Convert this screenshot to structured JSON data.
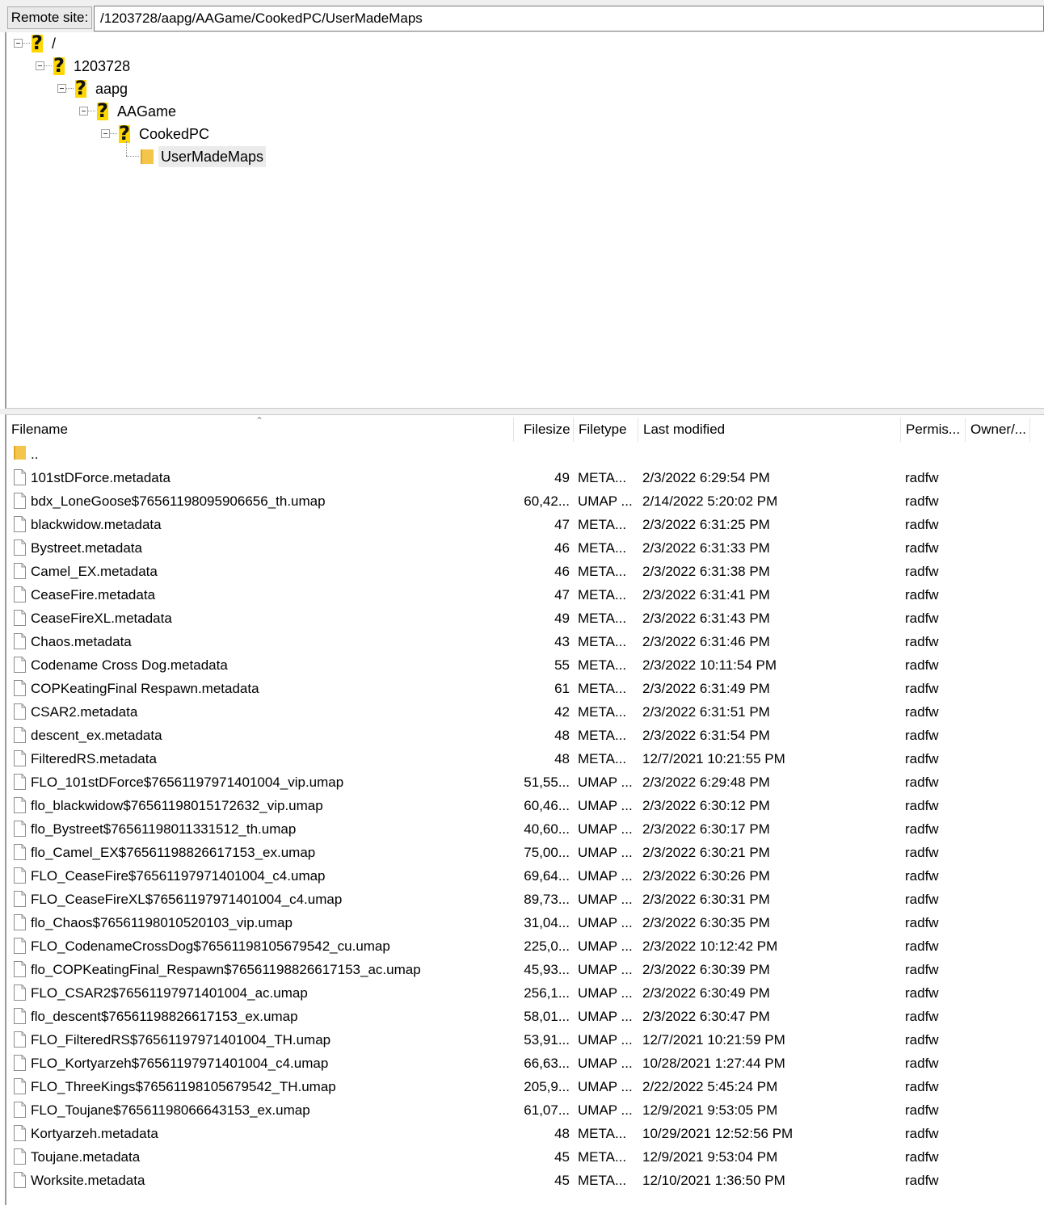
{
  "remote_site": {
    "label": "Remote site:",
    "path": "/1203728/aapg/AAGame/CookedPC/UserMadeMaps"
  },
  "tree": [
    {
      "label": "/",
      "icon": "question-folder-icon"
    },
    {
      "label": "1203728",
      "icon": "question-folder-icon"
    },
    {
      "label": "aapg",
      "icon": "question-folder-icon"
    },
    {
      "label": "AAGame",
      "icon": "question-folder-icon"
    },
    {
      "label": "CookedPC",
      "icon": "question-folder-icon"
    },
    {
      "label": "UserMadeMaps",
      "icon": "folder-icon",
      "selected": true
    }
  ],
  "columns": {
    "filename": "Filename",
    "filesize": "Filesize",
    "filetype": "Filetype",
    "last_modified": "Last modified",
    "permissions": "Permis...",
    "owner": "Owner/..."
  },
  "parent_dir": "..",
  "files": [
    {
      "name": "101stDForce.metadata",
      "size": "49",
      "type": "META...",
      "modified": "2/3/2022 6:29:54 PM",
      "perms": "radfw"
    },
    {
      "name": "bdx_LoneGoose$76561198095906656_th.umap",
      "size": "60,42...",
      "type": "UMAP ...",
      "modified": "2/14/2022 5:20:02 PM",
      "perms": "radfw"
    },
    {
      "name": "blackwidow.metadata",
      "size": "47",
      "type": "META...",
      "modified": "2/3/2022 6:31:25 PM",
      "perms": "radfw"
    },
    {
      "name": "Bystreet.metadata",
      "size": "46",
      "type": "META...",
      "modified": "2/3/2022 6:31:33 PM",
      "perms": "radfw"
    },
    {
      "name": "Camel_EX.metadata",
      "size": "46",
      "type": "META...",
      "modified": "2/3/2022 6:31:38 PM",
      "perms": "radfw"
    },
    {
      "name": "CeaseFire.metadata",
      "size": "47",
      "type": "META...",
      "modified": "2/3/2022 6:31:41 PM",
      "perms": "radfw"
    },
    {
      "name": "CeaseFireXL.metadata",
      "size": "49",
      "type": "META...",
      "modified": "2/3/2022 6:31:43 PM",
      "perms": "radfw"
    },
    {
      "name": "Chaos.metadata",
      "size": "43",
      "type": "META...",
      "modified": "2/3/2022 6:31:46 PM",
      "perms": "radfw"
    },
    {
      "name": "Codename Cross Dog.metadata",
      "size": "55",
      "type": "META...",
      "modified": "2/3/2022 10:11:54 PM",
      "perms": "radfw"
    },
    {
      "name": "COPKeatingFinal Respawn.metadata",
      "size": "61",
      "type": "META...",
      "modified": "2/3/2022 6:31:49 PM",
      "perms": "radfw"
    },
    {
      "name": "CSAR2.metadata",
      "size": "42",
      "type": "META...",
      "modified": "2/3/2022 6:31:51 PM",
      "perms": "radfw"
    },
    {
      "name": "descent_ex.metadata",
      "size": "48",
      "type": "META...",
      "modified": "2/3/2022 6:31:54 PM",
      "perms": "radfw"
    },
    {
      "name": "FilteredRS.metadata",
      "size": "48",
      "type": "META...",
      "modified": "12/7/2021 10:21:55 PM",
      "perms": "radfw"
    },
    {
      "name": "FLO_101stDForce$76561197971401004_vip.umap",
      "size": "51,55...",
      "type": "UMAP ...",
      "modified": "2/3/2022 6:29:48 PM",
      "perms": "radfw"
    },
    {
      "name": "flo_blackwidow$76561198015172632_vip.umap",
      "size": "60,46...",
      "type": "UMAP ...",
      "modified": "2/3/2022 6:30:12 PM",
      "perms": "radfw"
    },
    {
      "name": "flo_Bystreet$76561198011331512_th.umap",
      "size": "40,60...",
      "type": "UMAP ...",
      "modified": "2/3/2022 6:30:17 PM",
      "perms": "radfw"
    },
    {
      "name": "flo_Camel_EX$76561198826617153_ex.umap",
      "size": "75,00...",
      "type": "UMAP ...",
      "modified": "2/3/2022 6:30:21 PM",
      "perms": "radfw"
    },
    {
      "name": "FLO_CeaseFire$76561197971401004_c4.umap",
      "size": "69,64...",
      "type": "UMAP ...",
      "modified": "2/3/2022 6:30:26 PM",
      "perms": "radfw"
    },
    {
      "name": "FLO_CeaseFireXL$76561197971401004_c4.umap",
      "size": "89,73...",
      "type": "UMAP ...",
      "modified": "2/3/2022 6:30:31 PM",
      "perms": "radfw"
    },
    {
      "name": "flo_Chaos$76561198010520103_vip.umap",
      "size": "31,04...",
      "type": "UMAP ...",
      "modified": "2/3/2022 6:30:35 PM",
      "perms": "radfw"
    },
    {
      "name": "FLO_CodenameCrossDog$76561198105679542_cu.umap",
      "size": "225,0...",
      "type": "UMAP ...",
      "modified": "2/3/2022 10:12:42 PM",
      "perms": "radfw"
    },
    {
      "name": "flo_COPKeatingFinal_Respawn$76561198826617153_ac.umap",
      "size": "45,93...",
      "type": "UMAP ...",
      "modified": "2/3/2022 6:30:39 PM",
      "perms": "radfw"
    },
    {
      "name": "FLO_CSAR2$76561197971401004_ac.umap",
      "size": "256,1...",
      "type": "UMAP ...",
      "modified": "2/3/2022 6:30:49 PM",
      "perms": "radfw"
    },
    {
      "name": "flo_descent$76561198826617153_ex.umap",
      "size": "58,01...",
      "type": "UMAP ...",
      "modified": "2/3/2022 6:30:47 PM",
      "perms": "radfw"
    },
    {
      "name": "FLO_FilteredRS$76561197971401004_TH.umap",
      "size": "53,91...",
      "type": "UMAP ...",
      "modified": "12/7/2021 10:21:59 PM",
      "perms": "radfw"
    },
    {
      "name": "FLO_Kortyarzeh$76561197971401004_c4.umap",
      "size": "66,63...",
      "type": "UMAP ...",
      "modified": "10/28/2021 1:27:44 PM",
      "perms": "radfw"
    },
    {
      "name": "FLO_ThreeKings$76561198105679542_TH.umap",
      "size": "205,9...",
      "type": "UMAP ...",
      "modified": "2/22/2022 5:45:24 PM",
      "perms": "radfw"
    },
    {
      "name": "FLO_Toujane$76561198066643153_ex.umap",
      "size": "61,07...",
      "type": "UMAP ...",
      "modified": "12/9/2021 9:53:05 PM",
      "perms": "radfw"
    },
    {
      "name": "Kortyarzeh.metadata",
      "size": "48",
      "type": "META...",
      "modified": "10/29/2021 12:52:56 PM",
      "perms": "radfw"
    },
    {
      "name": "Toujane.metadata",
      "size": "45",
      "type": "META...",
      "modified": "12/9/2021 9:53:04 PM",
      "perms": "radfw"
    },
    {
      "name": "Worksite.metadata",
      "size": "45",
      "type": "META...",
      "modified": "12/10/2021 1:36:50 PM",
      "perms": "radfw"
    }
  ]
}
